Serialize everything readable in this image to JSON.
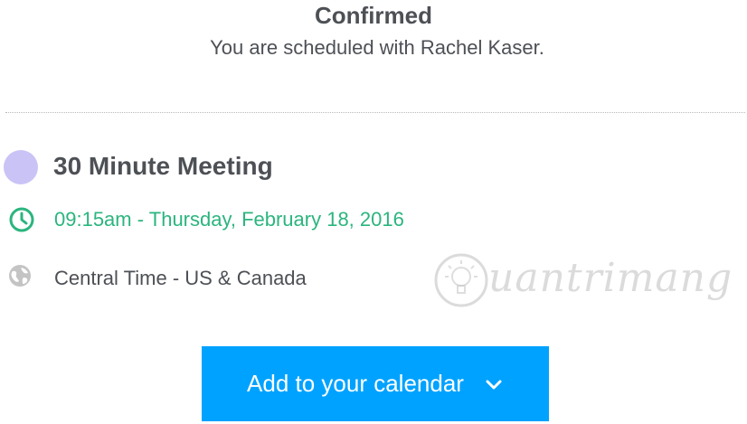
{
  "header": {
    "title": "Confirmed",
    "subtitle": "You are scheduled with Rachel Kaser."
  },
  "event": {
    "color": "#c9c3f6",
    "name": "30 Minute Meeting",
    "datetime": "09:15am - Thursday, February 18, 2016",
    "datetime_color": "#2bb57e",
    "timezone": "Central Time - US & Canada",
    "icons": [
      "clock-icon",
      "globe-icon"
    ]
  },
  "watermark": {
    "text": "uantrimang"
  },
  "actions": {
    "add_calendar_label": "Add to your calendar",
    "button_color": "#00a2ff"
  }
}
